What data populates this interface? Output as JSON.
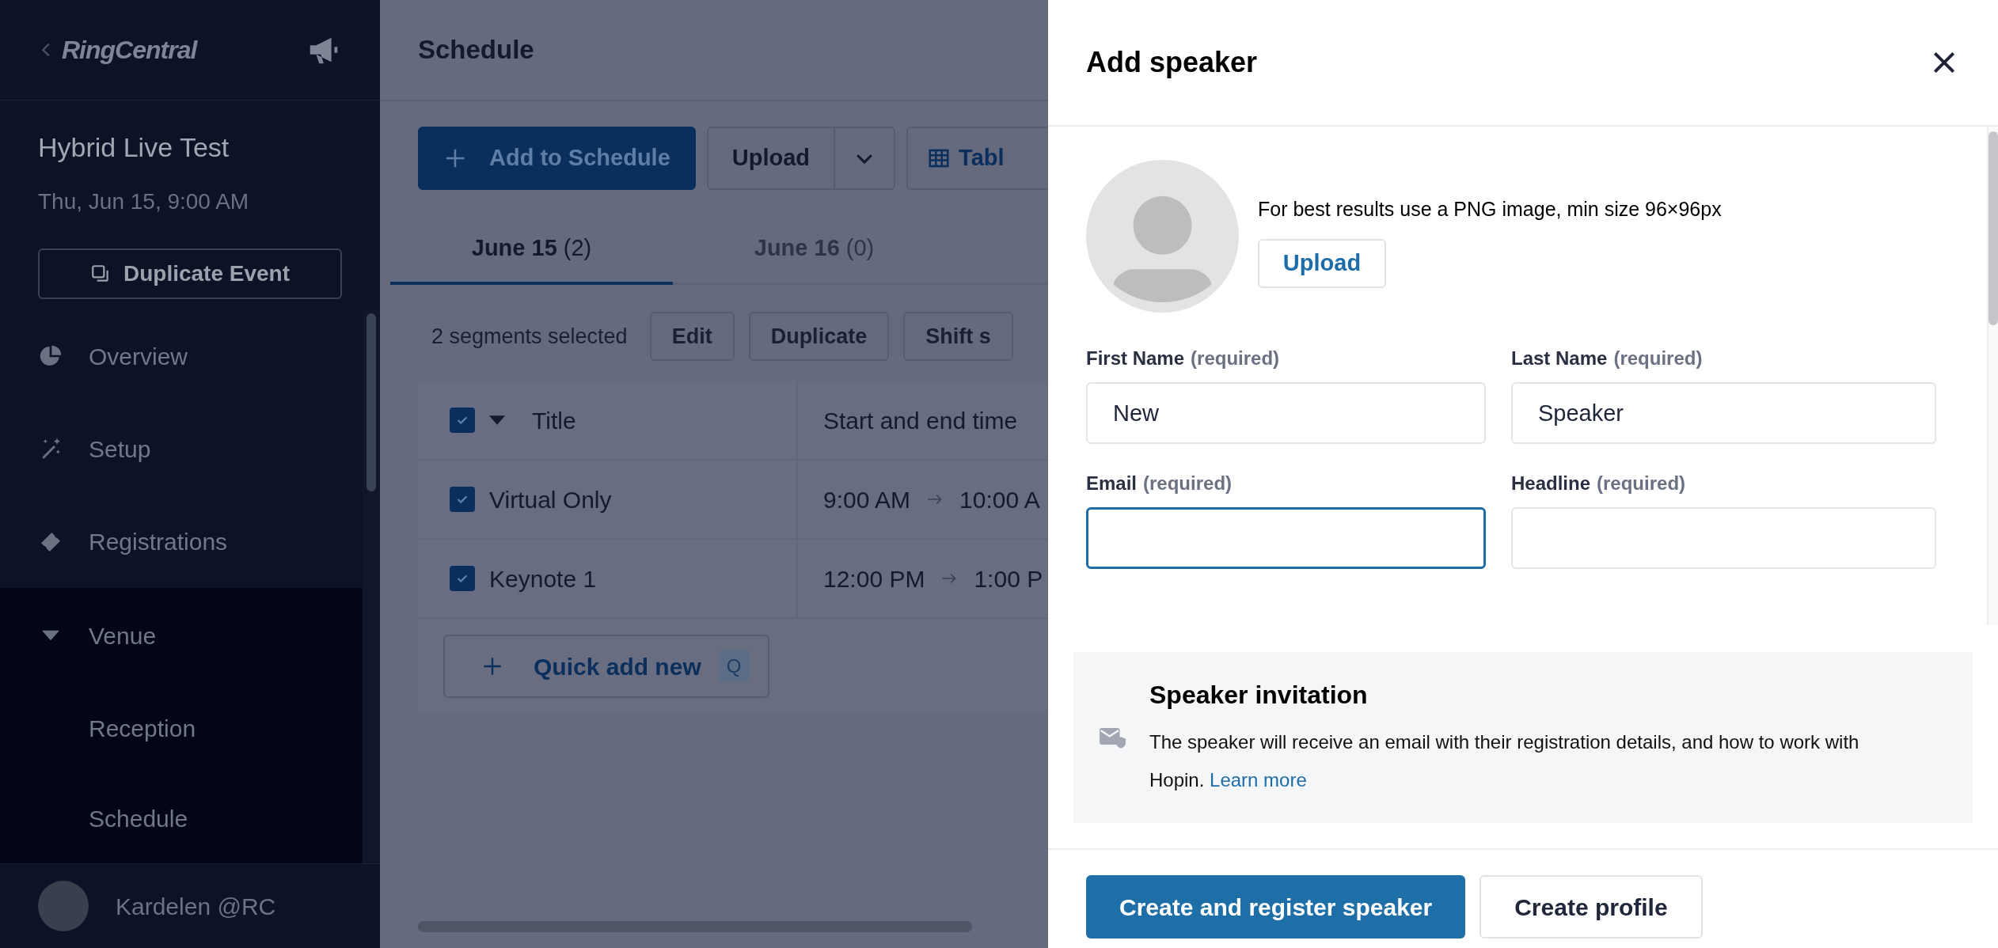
{
  "sidebar": {
    "brand": "RingCentral",
    "event_title": "Hybrid Live Test",
    "event_date": "Thu, Jun 15, 9:00 AM",
    "duplicate_button": "Duplicate Event",
    "nav_items": [
      {
        "label": "Overview",
        "kind": "link"
      },
      {
        "label": "Setup",
        "kind": "link"
      },
      {
        "label": "Registrations",
        "kind": "link"
      },
      {
        "label": "Venue",
        "kind": "group",
        "expanded": true,
        "children": [
          {
            "label": "Reception"
          },
          {
            "label": "Schedule"
          }
        ]
      }
    ],
    "user": {
      "name": "Kardelen @RC"
    }
  },
  "page": {
    "title": "Schedule",
    "toolbar": {
      "add_button": "Add to Schedule",
      "upload_button": "Upload",
      "table_button": "Tabl"
    },
    "tabs": [
      {
        "label": "June 15",
        "count": "(2)",
        "selected": true
      },
      {
        "label": "June 16",
        "count": "(0)",
        "selected": false
      }
    ],
    "selection": {
      "summary": "2 segments selected",
      "actions": [
        "Edit",
        "Duplicate",
        "Shift s"
      ]
    },
    "table": {
      "columns": [
        "Title",
        "Start and end time"
      ],
      "header_checked": true,
      "rows": [
        {
          "title": "Virtual Only",
          "start": "9:00 AM",
          "end": "10:00 A",
          "checked": true
        },
        {
          "title": "Keynote 1",
          "start": "12:00 PM",
          "end": "1:00 P",
          "checked": true
        }
      ]
    },
    "quick_add": {
      "label": "Quick add new",
      "shortcut": "Q"
    }
  },
  "drawer": {
    "title": "Add speaker",
    "photo_hint": "For best results use a PNG image, min size 96×96px",
    "upload_button": "Upload",
    "fields": [
      {
        "label": "First Name",
        "note": "(required)",
        "value": "New",
        "focused": false
      },
      {
        "label": "Last Name",
        "note": "(required)",
        "value": "Speaker",
        "focused": false
      },
      {
        "label": "Email",
        "note": "(required)",
        "focused": true
      },
      {
        "label": "Headline",
        "note": "(required)",
        "focused": false
      }
    ],
    "invitation": {
      "title": "Speaker invitation",
      "text": "The speaker will receive an email with their registration details, and how to work with Hopin.",
      "link": "Learn more"
    },
    "buttons": [
      {
        "label": "Create and register speaker",
        "kind": "primary"
      },
      {
        "label": "Create profile",
        "kind": "secondary"
      }
    ]
  }
}
